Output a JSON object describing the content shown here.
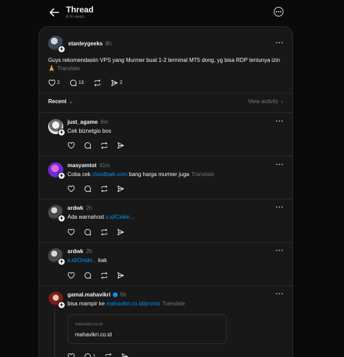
{
  "header": {
    "title": "Thread",
    "views": "674 views"
  },
  "main_post": {
    "username": "stanleygeeks",
    "time": "8h",
    "text": "Guys rekomendasiin VPS yang Murmer buat 1-2 terminal MT5 dong, yg bisa RDP tentunya izin 🙏",
    "translate": "Translate",
    "likes": "2",
    "replies": "13",
    "reposts": "",
    "shares": "2"
  },
  "sort": {
    "label": "Recent",
    "view_activity": "View activity"
  },
  "replies": [
    {
      "username": "just_agame",
      "time": "8m",
      "text": "Cek biznetgio bos",
      "link": "",
      "after": "",
      "translate": ""
    },
    {
      "username": "masyamtot",
      "time": "41m",
      "text": "Coba cek ",
      "link": "cloudbaik.com",
      "after": " bang harga murmer juga",
      "translate": "Translate"
    },
    {
      "username": "ardwk",
      "time": "2h",
      "text": "Ada warnahost ",
      "link": "s.id/Cekin...",
      "after": "",
      "translate": ""
    },
    {
      "username": "ardwk",
      "time": "2h",
      "text": "",
      "link": "s.id/Onide...",
      "after": " kak",
      "translate": ""
    },
    {
      "username": "gamal.mahavikri",
      "time": "5h",
      "text": "bisa mampir ke ",
      "link": "mahavikri.co.id/promo",
      "after": "",
      "translate": "Translate",
      "reply_count": "1"
    }
  ],
  "link_card": {
    "domain": "mahavikri.co.id",
    "title": "mahavikri.co.id"
  },
  "colors": {
    "accent": "#0095f6",
    "background": "#0a0a0a",
    "panel": "#181818",
    "verified": "#0095f6"
  }
}
